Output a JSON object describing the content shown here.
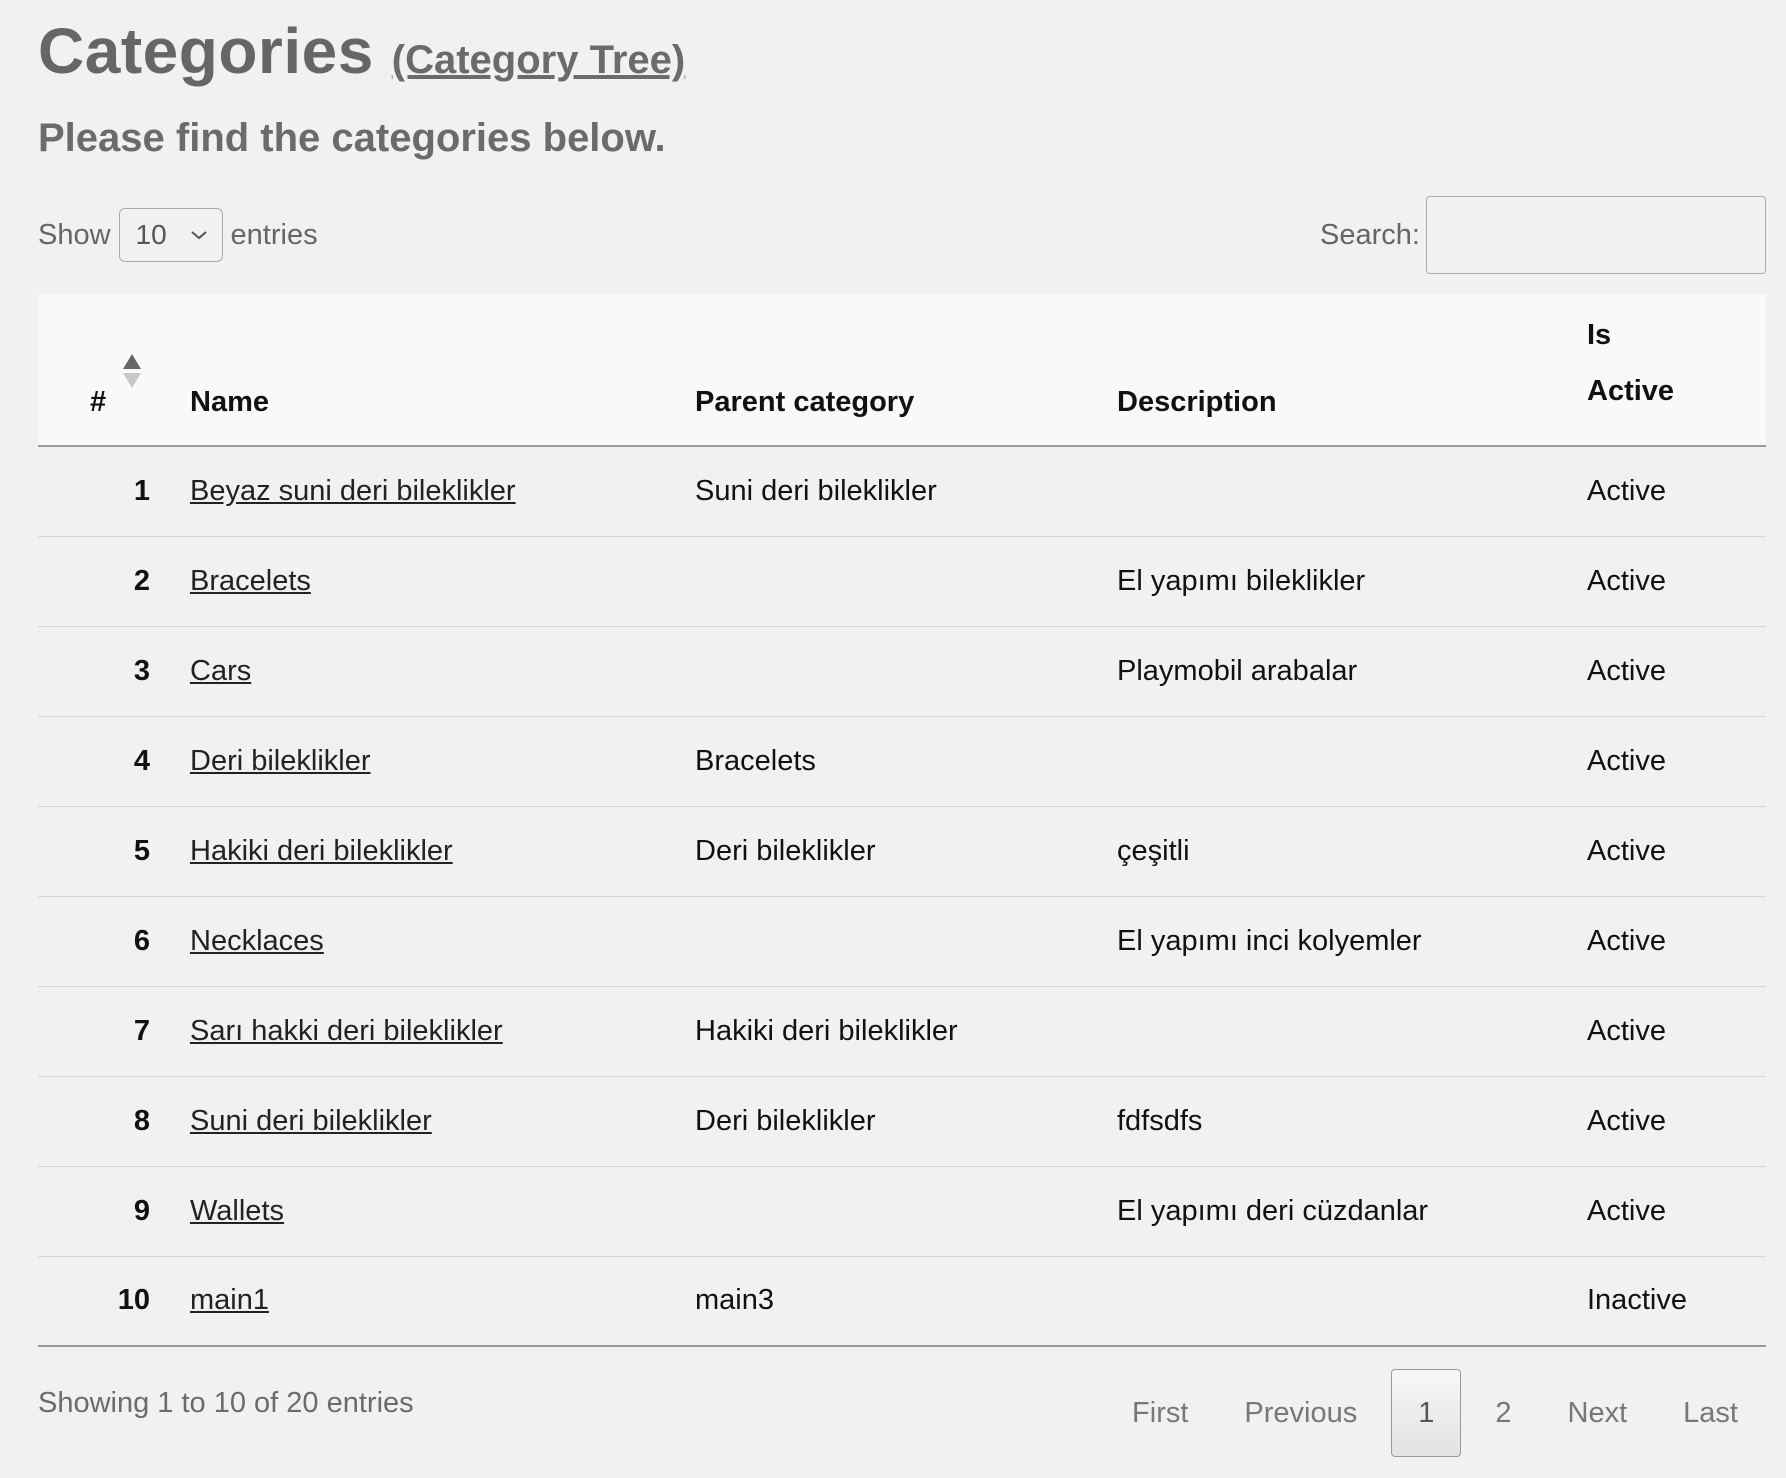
{
  "header": {
    "title": "Categories",
    "tree_link": "(Category Tree)",
    "subtitle": "Please find the categories below."
  },
  "controls": {
    "show_label": "Show",
    "page_size": "10",
    "entries_label": "entries",
    "search_label": "Search:",
    "search_value": ""
  },
  "table": {
    "columns": {
      "num": "#",
      "name": "Name",
      "parent": "Parent category",
      "description": "Description",
      "active_line1": "Is",
      "active_line2": "Active"
    },
    "rows": [
      {
        "num": "1",
        "name": "Beyaz suni deri bileklikler",
        "parent": "Suni deri bileklikler",
        "description": "",
        "status": "Active"
      },
      {
        "num": "2",
        "name": "Bracelets",
        "parent": "",
        "description": "El yapımı bileklikler",
        "status": "Active"
      },
      {
        "num": "3",
        "name": "Cars",
        "parent": "",
        "description": "Playmobil arabalar",
        "status": "Active"
      },
      {
        "num": "4",
        "name": "Deri bileklikler",
        "parent": "Bracelets",
        "description": "",
        "status": "Active"
      },
      {
        "num": "5",
        "name": "Hakiki deri bileklikler",
        "parent": "Deri bileklikler",
        "description": "çeşitli",
        "status": "Active"
      },
      {
        "num": "6",
        "name": "Necklaces",
        "parent": "",
        "description": "El yapımı inci kolyemler",
        "status": "Active"
      },
      {
        "num": "7",
        "name": "Sarı hakki deri bileklikler",
        "parent": "Hakiki deri bileklikler",
        "description": "",
        "status": "Active"
      },
      {
        "num": "8",
        "name": "Suni deri bileklikler",
        "parent": "Deri bileklikler",
        "description": "fdfsdfs",
        "status": "Active"
      },
      {
        "num": "9",
        "name": "Wallets",
        "parent": "",
        "description": "El yapımı deri cüzdanlar",
        "status": "Active"
      },
      {
        "num": "10",
        "name": "main1",
        "parent": "main3",
        "description": "",
        "status": "Inactive"
      }
    ]
  },
  "footer": {
    "info": "Showing 1 to 10 of 20 entries",
    "pager": {
      "first": "First",
      "previous": "Previous",
      "pages": [
        "1",
        "2"
      ],
      "next": "Next",
      "last": "Last"
    }
  },
  "icons": {
    "sort": "sort-ascending-icon",
    "select": "chevron-down-icon"
  }
}
